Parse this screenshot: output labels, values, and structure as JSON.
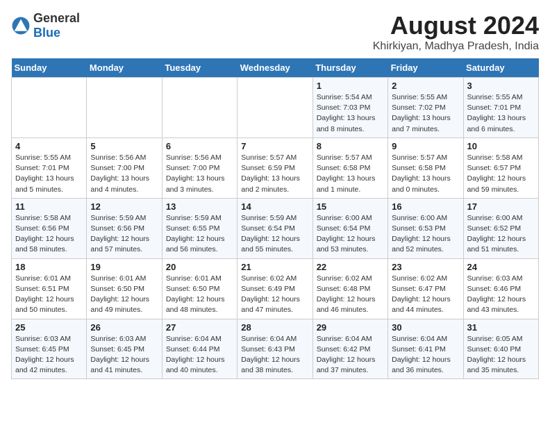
{
  "header": {
    "logo_general": "General",
    "logo_blue": "Blue",
    "title": "August 2024",
    "subtitle": "Khirkiyan, Madhya Pradesh, India"
  },
  "days_of_week": [
    "Sunday",
    "Monday",
    "Tuesday",
    "Wednesday",
    "Thursday",
    "Friday",
    "Saturday"
  ],
  "weeks": [
    [
      {
        "day": "",
        "info": ""
      },
      {
        "day": "",
        "info": ""
      },
      {
        "day": "",
        "info": ""
      },
      {
        "day": "",
        "info": ""
      },
      {
        "day": "1",
        "info": "Sunrise: 5:54 AM\nSunset: 7:03 PM\nDaylight: 13 hours\nand 8 minutes."
      },
      {
        "day": "2",
        "info": "Sunrise: 5:55 AM\nSunset: 7:02 PM\nDaylight: 13 hours\nand 7 minutes."
      },
      {
        "day": "3",
        "info": "Sunrise: 5:55 AM\nSunset: 7:01 PM\nDaylight: 13 hours\nand 6 minutes."
      }
    ],
    [
      {
        "day": "4",
        "info": "Sunrise: 5:55 AM\nSunset: 7:01 PM\nDaylight: 13 hours\nand 5 minutes."
      },
      {
        "day": "5",
        "info": "Sunrise: 5:56 AM\nSunset: 7:00 PM\nDaylight: 13 hours\nand 4 minutes."
      },
      {
        "day": "6",
        "info": "Sunrise: 5:56 AM\nSunset: 7:00 PM\nDaylight: 13 hours\nand 3 minutes."
      },
      {
        "day": "7",
        "info": "Sunrise: 5:57 AM\nSunset: 6:59 PM\nDaylight: 13 hours\nand 2 minutes."
      },
      {
        "day": "8",
        "info": "Sunrise: 5:57 AM\nSunset: 6:58 PM\nDaylight: 13 hours\nand 1 minute."
      },
      {
        "day": "9",
        "info": "Sunrise: 5:57 AM\nSunset: 6:58 PM\nDaylight: 13 hours\nand 0 minutes."
      },
      {
        "day": "10",
        "info": "Sunrise: 5:58 AM\nSunset: 6:57 PM\nDaylight: 12 hours\nand 59 minutes."
      }
    ],
    [
      {
        "day": "11",
        "info": "Sunrise: 5:58 AM\nSunset: 6:56 PM\nDaylight: 12 hours\nand 58 minutes."
      },
      {
        "day": "12",
        "info": "Sunrise: 5:59 AM\nSunset: 6:56 PM\nDaylight: 12 hours\nand 57 minutes."
      },
      {
        "day": "13",
        "info": "Sunrise: 5:59 AM\nSunset: 6:55 PM\nDaylight: 12 hours\nand 56 minutes."
      },
      {
        "day": "14",
        "info": "Sunrise: 5:59 AM\nSunset: 6:54 PM\nDaylight: 12 hours\nand 55 minutes."
      },
      {
        "day": "15",
        "info": "Sunrise: 6:00 AM\nSunset: 6:54 PM\nDaylight: 12 hours\nand 53 minutes."
      },
      {
        "day": "16",
        "info": "Sunrise: 6:00 AM\nSunset: 6:53 PM\nDaylight: 12 hours\nand 52 minutes."
      },
      {
        "day": "17",
        "info": "Sunrise: 6:00 AM\nSunset: 6:52 PM\nDaylight: 12 hours\nand 51 minutes."
      }
    ],
    [
      {
        "day": "18",
        "info": "Sunrise: 6:01 AM\nSunset: 6:51 PM\nDaylight: 12 hours\nand 50 minutes."
      },
      {
        "day": "19",
        "info": "Sunrise: 6:01 AM\nSunset: 6:50 PM\nDaylight: 12 hours\nand 49 minutes."
      },
      {
        "day": "20",
        "info": "Sunrise: 6:01 AM\nSunset: 6:50 PM\nDaylight: 12 hours\nand 48 minutes."
      },
      {
        "day": "21",
        "info": "Sunrise: 6:02 AM\nSunset: 6:49 PM\nDaylight: 12 hours\nand 47 minutes."
      },
      {
        "day": "22",
        "info": "Sunrise: 6:02 AM\nSunset: 6:48 PM\nDaylight: 12 hours\nand 46 minutes."
      },
      {
        "day": "23",
        "info": "Sunrise: 6:02 AM\nSunset: 6:47 PM\nDaylight: 12 hours\nand 44 minutes."
      },
      {
        "day": "24",
        "info": "Sunrise: 6:03 AM\nSunset: 6:46 PM\nDaylight: 12 hours\nand 43 minutes."
      }
    ],
    [
      {
        "day": "25",
        "info": "Sunrise: 6:03 AM\nSunset: 6:45 PM\nDaylight: 12 hours\nand 42 minutes."
      },
      {
        "day": "26",
        "info": "Sunrise: 6:03 AM\nSunset: 6:45 PM\nDaylight: 12 hours\nand 41 minutes."
      },
      {
        "day": "27",
        "info": "Sunrise: 6:04 AM\nSunset: 6:44 PM\nDaylight: 12 hours\nand 40 minutes."
      },
      {
        "day": "28",
        "info": "Sunrise: 6:04 AM\nSunset: 6:43 PM\nDaylight: 12 hours\nand 38 minutes."
      },
      {
        "day": "29",
        "info": "Sunrise: 6:04 AM\nSunset: 6:42 PM\nDaylight: 12 hours\nand 37 minutes."
      },
      {
        "day": "30",
        "info": "Sunrise: 6:04 AM\nSunset: 6:41 PM\nDaylight: 12 hours\nand 36 minutes."
      },
      {
        "day": "31",
        "info": "Sunrise: 6:05 AM\nSunset: 6:40 PM\nDaylight: 12 hours\nand 35 minutes."
      }
    ]
  ]
}
